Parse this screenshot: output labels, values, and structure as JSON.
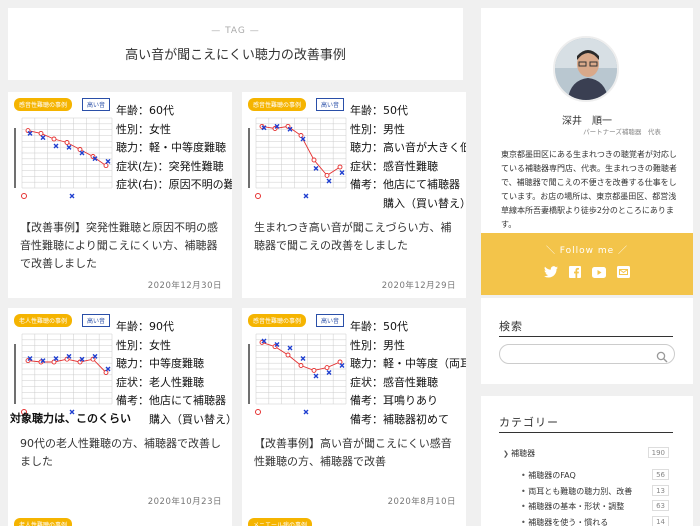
{
  "tag": {
    "label": "— TAG —",
    "title": "高い音が聞こえにくい聴力の改善事例"
  },
  "cards": [
    {
      "badge": "感音性難聴の事例",
      "badge2": "高い音",
      "info": [
        "年齢：60代",
        "性別：女性",
        "聴力：軽・中等度難聴",
        "症状(左)：突発性難聴",
        "症状(右)：原因不明の難聴"
      ],
      "caption": "",
      "title": "【改善事例】突発性難聴と原因不明の感音性難聴により聞こえにくい方、補聴器で改善しました",
      "date": "2020年12月30日"
    },
    {
      "badge": "感音性難聴の事例",
      "badge2": "高い音",
      "info": [
        "年齢：50代",
        "性別：男性",
        "聴力：高い音が大きく低下",
        "症状：感音性難聴",
        "備考：他店にて補聴器",
        "　　　購入（買い替え）"
      ],
      "caption": "",
      "title": "生まれつき高い音が聞こえづらい方、補聴器で聞こえの改善をしました",
      "date": "2020年12月29日"
    },
    {
      "badge": "老人性難聴の事例",
      "badge2": "高い音",
      "info": [
        "年齢：90代",
        "性別：女性",
        "聴力：中等度難聴",
        "症状：老人性難聴",
        "備考：他店にて補聴器",
        "　　　購入（買い替え）"
      ],
      "caption": "対象聴力は、このくらい",
      "title": "90代の老人性難聴の方、補聴器で改善しました",
      "date": "2020年10月23日"
    },
    {
      "badge": "感音性難聴の事例",
      "badge2": "高い音",
      "info": [
        "年齢：50代",
        "性別：男性",
        "聴力：軽・中等度（両耳）",
        "症状：感音性難聴",
        "備考：耳鳴りあり",
        "備考：補聴器初めて"
      ],
      "caption": "",
      "title": "【改善事例】高い音が聞こえにくい感音性難聴の方、補聴器で改善",
      "date": "2020年8月10日"
    }
  ],
  "partial_cards": [
    {
      "badge": "老人性難聴の事例"
    },
    {
      "badge": "メニエール病の事例"
    }
  ],
  "profile": {
    "name": "深井　順一",
    "role": "パートナーズ補聴器　代表",
    "desc": "東京都墨田区にある生まれつきの聴覚者が対応している補聴器専門店、代表。生まれつきの難聴者で、補聴器で聞こえの不便さを改善する仕事をしています。お店の場所は、東京都墨田区、都営浅草線本所吾妻橋駅より徒歩2分のところにあります。",
    "follow_label": "＼ Follow me ／",
    "social": [
      "twitter-icon",
      "facebook-icon",
      "youtube-icon",
      "mail-icon"
    ]
  },
  "search": {
    "title": "検索",
    "placeholder": ""
  },
  "categories": {
    "title": "カテゴリー",
    "items": [
      {
        "label": "補聴器",
        "count": "190",
        "level": 0
      },
      {
        "label": "補聴器のFAQ",
        "count": "56",
        "level": 1
      },
      {
        "label": "両耳とも難聴の聴力別、改善",
        "count": "13",
        "level": 1
      },
      {
        "label": "補聴器の基本・形状・調整",
        "count": "63",
        "level": 1
      },
      {
        "label": "補聴器を使う・慣れる",
        "count": "14",
        "level": 1
      }
    ]
  },
  "colors": {
    "accent": "#f3c44a",
    "badge": "#f5b400",
    "chart_red": "#e53030",
    "chart_blue": "#1f3fd0"
  }
}
